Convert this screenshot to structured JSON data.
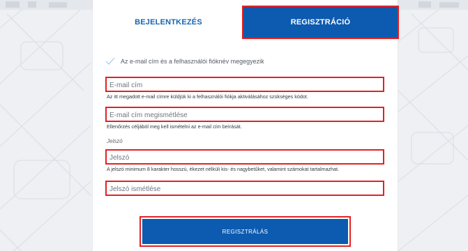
{
  "tabs": {
    "login_label": "BEJELENTKEZÉS",
    "register_label": "REGISZTRÁCIÓ"
  },
  "consent": {
    "label": "Az e-mail cím és a felhasználói fióknév megegyezik",
    "checked": true
  },
  "email": {
    "placeholder": "E-mail cím",
    "value": "",
    "hint": "Az itt megadott e-mail címre küldjük ki a felhasználói fiókja aktiválásához szükséges kódot."
  },
  "email_confirm": {
    "placeholder": "E-mail cím megismétlése",
    "value": "",
    "hint": "Ellenőrzés céljából meg kell ismételni az e-mail cím beírását."
  },
  "password_section_label": "Jelszó",
  "password": {
    "placeholder": "Jelszó",
    "value": "",
    "hint": "A jelszó minimum 8 karakter hosszú, ékezet nélküli kis- és nagybetűket, valamint számokat tartalmazhat."
  },
  "password_confirm": {
    "placeholder": "Jelszó ismétlése",
    "value": ""
  },
  "submit_label": "REGISZTRÁLÁS",
  "colors": {
    "primary": "#0c5bb0",
    "highlight": "#e22126",
    "tab_text": "#1565b4",
    "background": "#eef0f3"
  }
}
